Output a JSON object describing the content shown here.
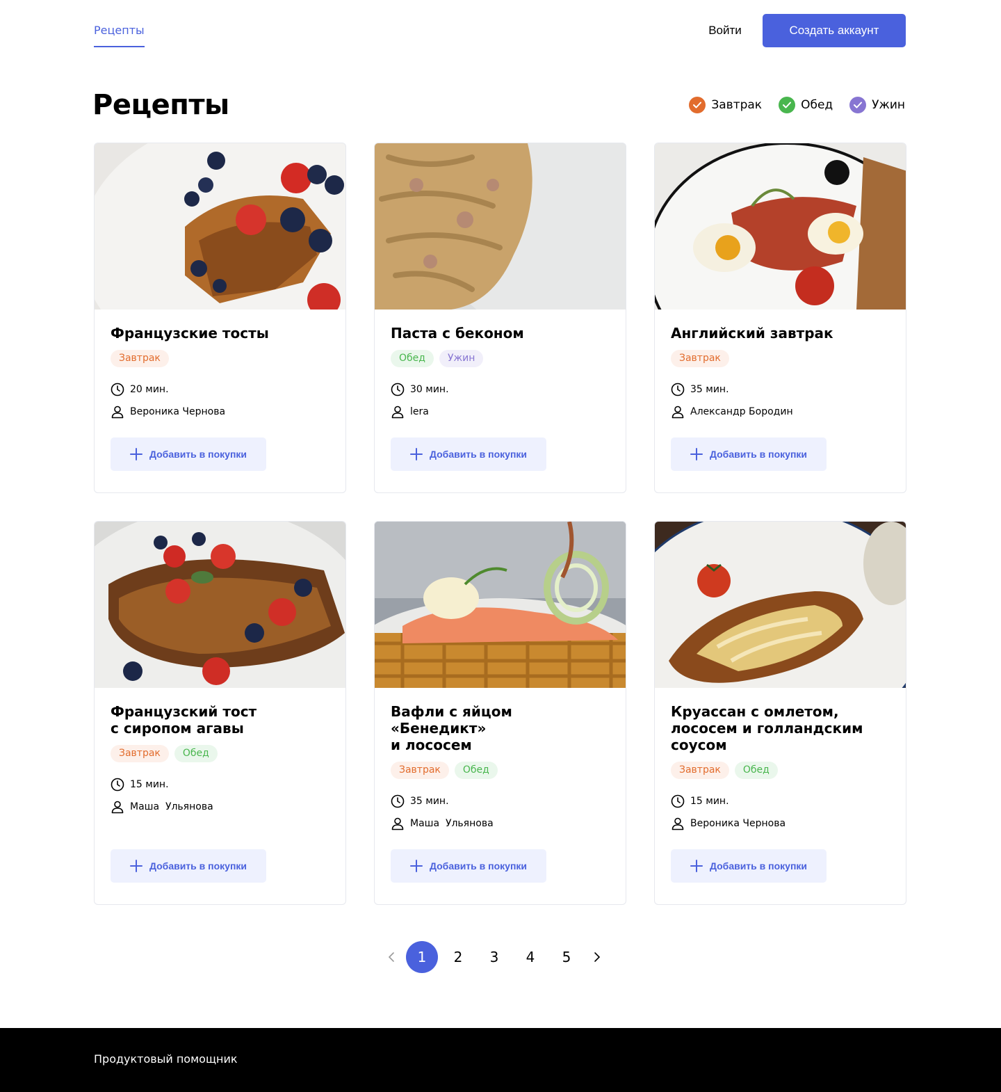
{
  "header": {
    "nav_recipes": "Рецепты",
    "login": "Войти",
    "signup": "Создать аккаунт"
  },
  "page": {
    "title": "Рецепты",
    "filters": [
      {
        "label": "Завтрак",
        "color": "#e26c2d"
      },
      {
        "label": "Обед",
        "color": "#49b64e"
      },
      {
        "label": "Ужин",
        "color": "#8775d2"
      }
    ]
  },
  "recipes": [
    {
      "title": "Французские тосты",
      "tags": [
        "Завтрак"
      ],
      "time": "20 мин.",
      "author": "Вероника Чернова",
      "add_label": "Добавить в покупки",
      "image": "french-toast-berries"
    },
    {
      "title": "Паста с беконом",
      "tags": [
        "Обед",
        "Ужин"
      ],
      "time": "30 мин.",
      "author": "lera",
      "add_label": "Добавить в покупки",
      "image": "pasta-bacon"
    },
    {
      "title": "Английский завтрак",
      "tags": [
        "Завтрак"
      ],
      "time": "35 мин.",
      "author": "Александр Бородин",
      "add_label": "Добавить в покупки",
      "image": "english-breakfast"
    },
    {
      "title": "Французский тост\nс сиропом агавы",
      "tags": [
        "Завтрак",
        "Обед"
      ],
      "time": "15 мин.",
      "author": "Маша  Ульянова",
      "add_label": "Добавить в покупки",
      "image": "french-toast-agave"
    },
    {
      "title": "Вафли с яйцом «Бенедикт»\nи лососем",
      "tags": [
        "Завтрак",
        "Обед"
      ],
      "time": "35 мин.",
      "author": "Маша  Ульянова",
      "add_label": "Добавить в покупки",
      "image": "waffles-benedict-salmon"
    },
    {
      "title": "Круассан с омлетом,\nлососем и голландским\nсоусом",
      "tags": [
        "Завтрак",
        "Обед"
      ],
      "time": "15 мин.",
      "author": "Вероника Чернова",
      "add_label": "Добавить в покупки",
      "image": "croissant-omelet"
    }
  ],
  "pagination": {
    "pages": [
      "1",
      "2",
      "3",
      "4",
      "5"
    ],
    "current": "1"
  },
  "footer": {
    "text": "Продуктовый помощник"
  },
  "colors": {
    "accent": "#4a61dd",
    "breakfast": "#e26c2d",
    "lunch": "#49b64e",
    "dinner": "#8775d2"
  }
}
